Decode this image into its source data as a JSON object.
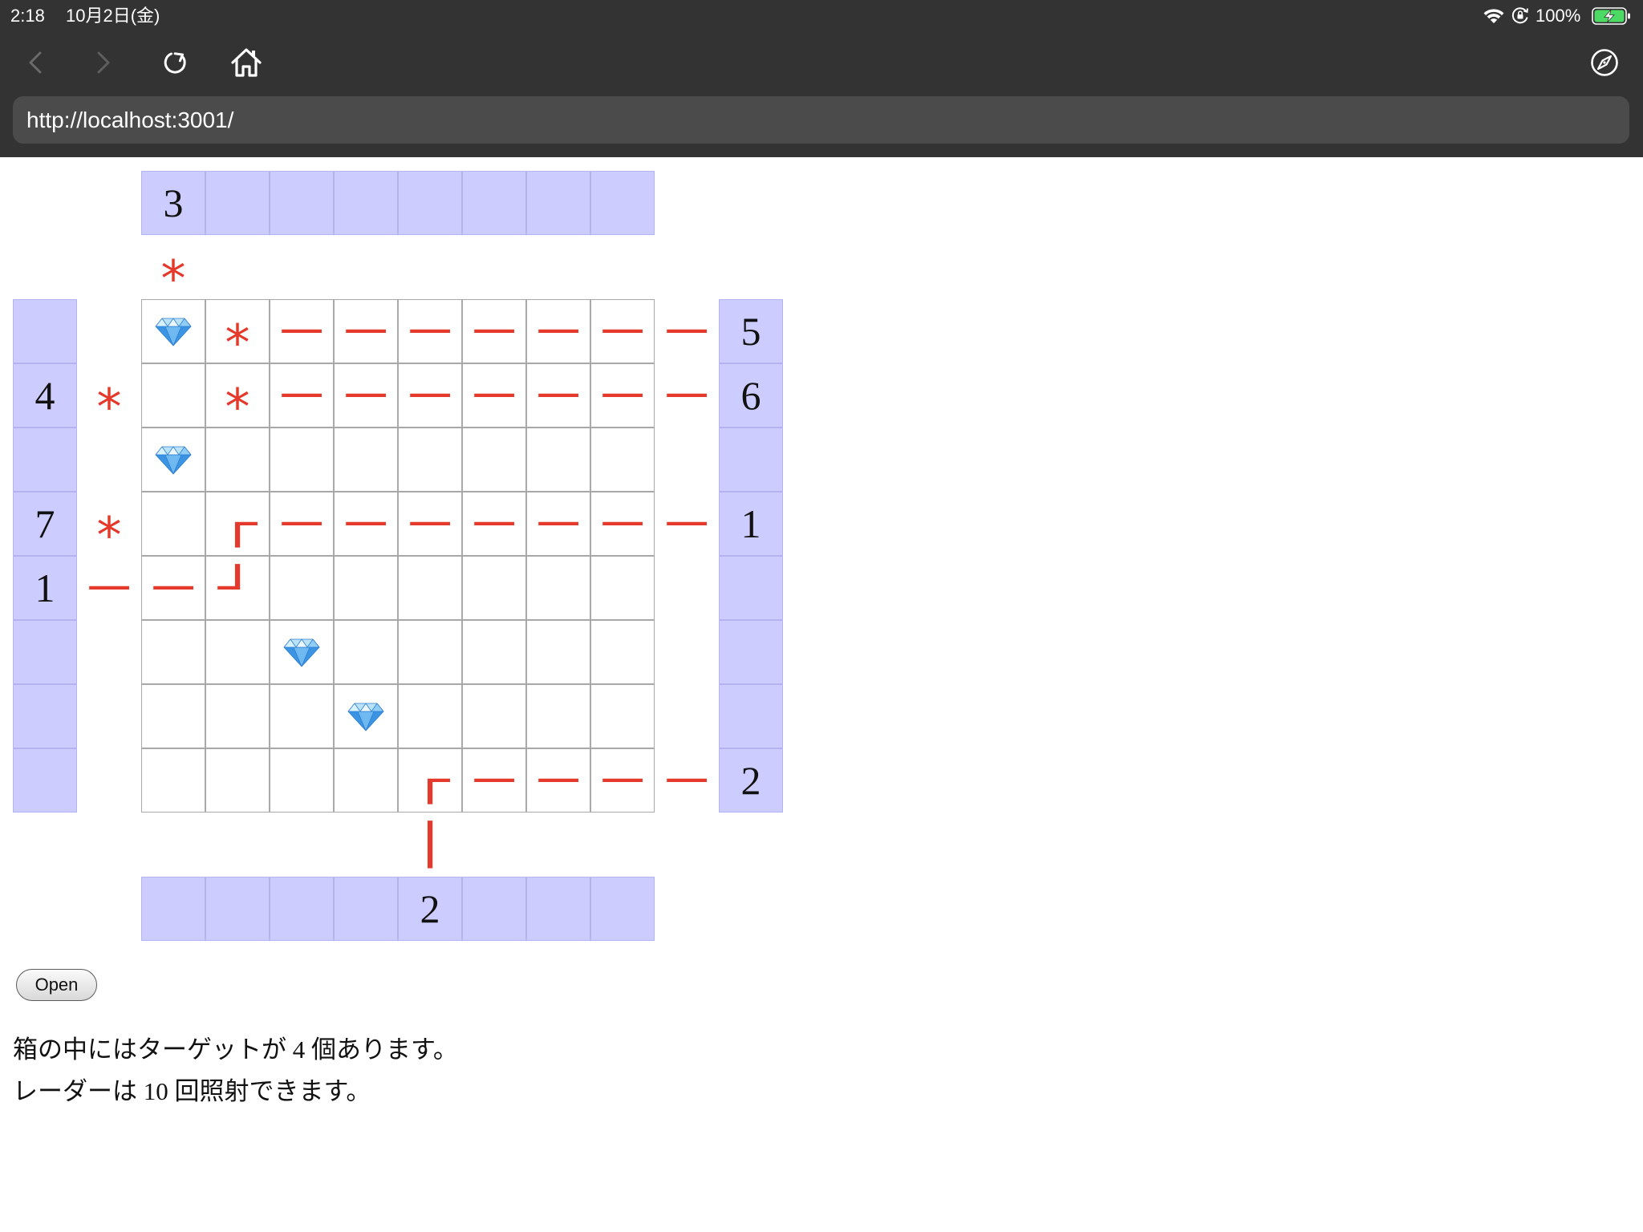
{
  "status_bar": {
    "time": "2:18",
    "date": "10月2日(金)",
    "battery_percent": "100%",
    "battery_level": 1.0,
    "icons": [
      "wifi-icon",
      "orientation-lock-icon",
      "battery-charging-icon"
    ]
  },
  "toolbar": {
    "icons": [
      "back-icon",
      "forward-icon",
      "reload-icon",
      "home-icon",
      "compass-icon"
    ],
    "url": "http://localhost:3001/"
  },
  "board": {
    "top_labels": [
      "3",
      "",
      "",
      "",
      "",
      "",
      "",
      ""
    ],
    "top_arrows": [
      "*",
      "",
      "",
      "",
      "",
      "",
      "",
      ""
    ],
    "left_labels": [
      "",
      "4",
      "",
      "7",
      "1",
      "",
      "",
      ""
    ],
    "left_arrows": [
      "",
      "*",
      "",
      "*",
      "─",
      "",
      "",
      ""
    ],
    "right_arrows": [
      "─",
      "─",
      "",
      "─",
      "",
      "",
      "",
      "─"
    ],
    "right_labels": [
      "5",
      "6",
      "",
      "1",
      "",
      "",
      "",
      "2"
    ],
    "bottom_arrows": [
      "",
      "",
      "",
      "",
      "│",
      "",
      "",
      ""
    ],
    "bottom_labels": [
      "",
      "",
      "",
      "",
      "2",
      "",
      "",
      ""
    ],
    "grid": [
      [
        "gem-icon",
        "*",
        "─",
        "─",
        "─",
        "─",
        "─",
        "─"
      ],
      [
        "",
        "*",
        "─",
        "─",
        "─",
        "─",
        "─",
        "─"
      ],
      [
        "gem-icon",
        "",
        "",
        "",
        "",
        "",
        "",
        ""
      ],
      [
        "",
        "┌",
        "─",
        "─",
        "─",
        "─",
        "─",
        "─"
      ],
      [
        "─",
        "┘",
        "",
        "",
        "",
        "",
        "",
        ""
      ],
      [
        "",
        "",
        "gem-icon",
        "",
        "",
        "",
        "",
        ""
      ],
      [
        "",
        "",
        "",
        "gem-icon",
        "",
        "",
        "",
        ""
      ],
      [
        "",
        "",
        "",
        "",
        "┌",
        "─",
        "─",
        "─"
      ]
    ]
  },
  "controls": {
    "open_label": "Open"
  },
  "messages": [
    "箱の中にはターゲットが 4 個あります。",
    "レーダーは 10 回照射できます。"
  ],
  "colors": {
    "chrome_bg": "#333333",
    "url_bg": "#4b4b4b",
    "label_bg": "#ccccff",
    "trace": "#e4392b",
    "battery": "#4cd964",
    "gem_light": "#b9e3fb",
    "gem_dark": "#3a93e3"
  }
}
